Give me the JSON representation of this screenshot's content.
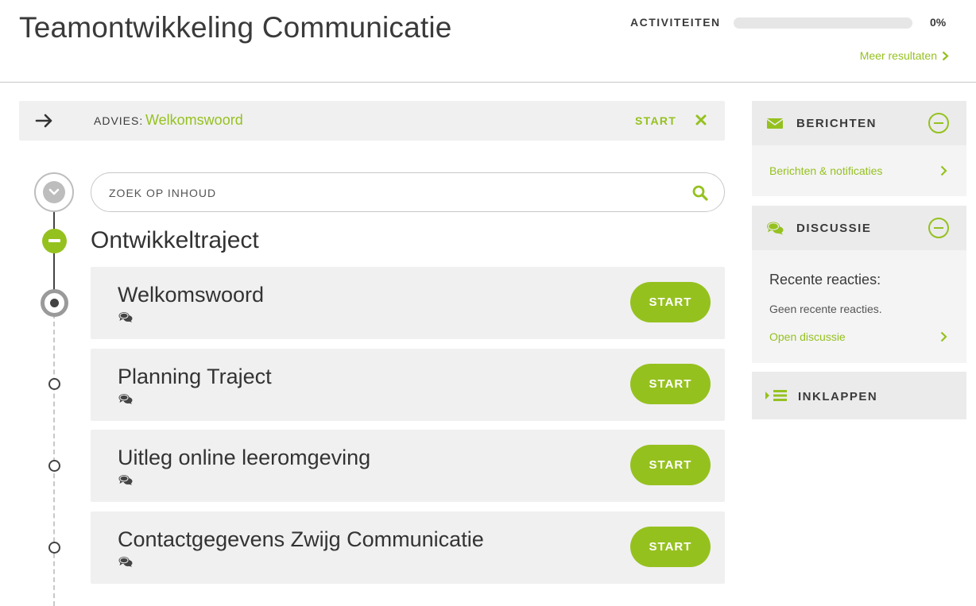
{
  "header": {
    "title": "Teamontwikkeling Communicatie",
    "activities_label": "ACTIVITEITEN",
    "progress_fraction": 0,
    "progress_text": "0%",
    "more_results": "Meer resultaten"
  },
  "advice": {
    "label": "ADVIES:",
    "link": "Welkomswoord",
    "start": "START"
  },
  "search": {
    "placeholder": "ZOEK OP INHOUD"
  },
  "section": {
    "title": "Ontwikkeltraject"
  },
  "modules": [
    {
      "title": "Welkomswoord",
      "button": "START"
    },
    {
      "title": "Planning Traject",
      "button": "START"
    },
    {
      "title": "Uitleg online leeromgeving",
      "button": "START"
    },
    {
      "title": "Contactgegevens Zwijg Communicatie",
      "button": "START"
    }
  ],
  "sidebar": {
    "messages": {
      "title": "BERICHTEN",
      "link": "Berichten & notificaties"
    },
    "discussion": {
      "title": "DISCUSSIE",
      "subtitle": "Recente reacties:",
      "empty": "Geen recente reacties.",
      "link": "Open discussie"
    },
    "collapse": {
      "title": "INKLAPPEN"
    }
  },
  "colors": {
    "accent": "#95c11f",
    "card_bg": "#f0f0f0",
    "text": "#333333"
  }
}
